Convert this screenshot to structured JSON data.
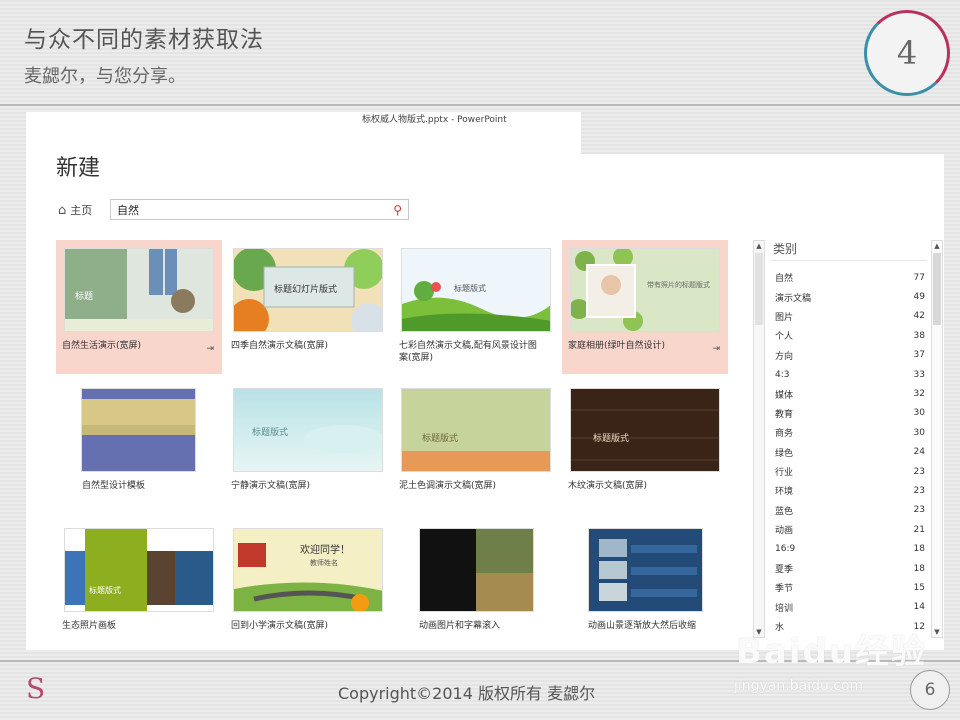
{
  "slide": {
    "title": "与众不同的素材获取法",
    "subtitle": "麦勰尔，与您分享。",
    "step_number": "4"
  },
  "window": {
    "title": "标权威人物版式.pptx - PowerPoint",
    "heading": "新建",
    "home_label": "主页",
    "search_value": "自然"
  },
  "templates": [
    {
      "label": "自然生活演示(宽屏)",
      "thumb_text": "标题",
      "highlighted": true,
      "pinned": true
    },
    {
      "label": "四季自然演示文稿(宽屏)",
      "thumb_text": "标题幻灯片版式",
      "highlighted": false,
      "pinned": false
    },
    {
      "label": "七彩自然演示文稿,配有风景设计图案(宽屏)",
      "thumb_text": "标题版式",
      "highlighted": false,
      "pinned": false
    },
    {
      "label": "家庭相册(绿叶自然设计)",
      "thumb_text": "带有照片的标题版式",
      "highlighted": true,
      "pinned": true
    },
    {
      "label": "自然型设计模板",
      "thumb_text": "",
      "highlighted": false,
      "pinned": false
    },
    {
      "label": "宁静演示文稿(宽屏)",
      "thumb_text": "标题版式",
      "highlighted": false,
      "pinned": false
    },
    {
      "label": "泥土色调演示文稿(宽屏)",
      "thumb_text": "标题版式",
      "highlighted": false,
      "pinned": false
    },
    {
      "label": "木纹演示文稿(宽屏)",
      "thumb_text": "标题版式",
      "highlighted": false,
      "pinned": false
    },
    {
      "label": "生态照片画板",
      "thumb_text": "标题版式",
      "highlighted": false,
      "pinned": false
    },
    {
      "label": "回到小学演示文稿(宽屏)",
      "thumb_text": "欢迎同学！",
      "thumb_subtext": "教师姓名",
      "highlighted": false,
      "pinned": false
    },
    {
      "label": "动画图片和字幕滚入",
      "thumb_text": "",
      "highlighted": false,
      "pinned": false
    },
    {
      "label": "动画山景逐渐放大然后收缩",
      "thumb_text": "",
      "highlighted": false,
      "pinned": false
    }
  ],
  "categories": {
    "header": "类别",
    "items": [
      {
        "name": "自然",
        "count": "77"
      },
      {
        "name": "演示文稿",
        "count": "49"
      },
      {
        "name": "图片",
        "count": "42"
      },
      {
        "name": "个人",
        "count": "38"
      },
      {
        "name": "方向",
        "count": "37"
      },
      {
        "name": "4:3",
        "count": "33"
      },
      {
        "name": "媒体",
        "count": "32"
      },
      {
        "name": "教育",
        "count": "30"
      },
      {
        "name": "商务",
        "count": "30"
      },
      {
        "name": "绿色",
        "count": "24"
      },
      {
        "name": "行业",
        "count": "23"
      },
      {
        "name": "环境",
        "count": "23"
      },
      {
        "name": "蓝色",
        "count": "23"
      },
      {
        "name": "动画",
        "count": "21"
      },
      {
        "name": "16:9",
        "count": "18"
      },
      {
        "name": "夏季",
        "count": "18"
      },
      {
        "name": "季节",
        "count": "15"
      },
      {
        "name": "培训",
        "count": "14"
      },
      {
        "name": "水",
        "count": "12"
      }
    ]
  },
  "footer": {
    "logo": "S",
    "copyright": "Copyright©2014 版权所有 麦勰尔",
    "page_number": "6"
  },
  "watermark": {
    "brand": "Baidu经验",
    "url": "jingyan.baidu.com"
  }
}
